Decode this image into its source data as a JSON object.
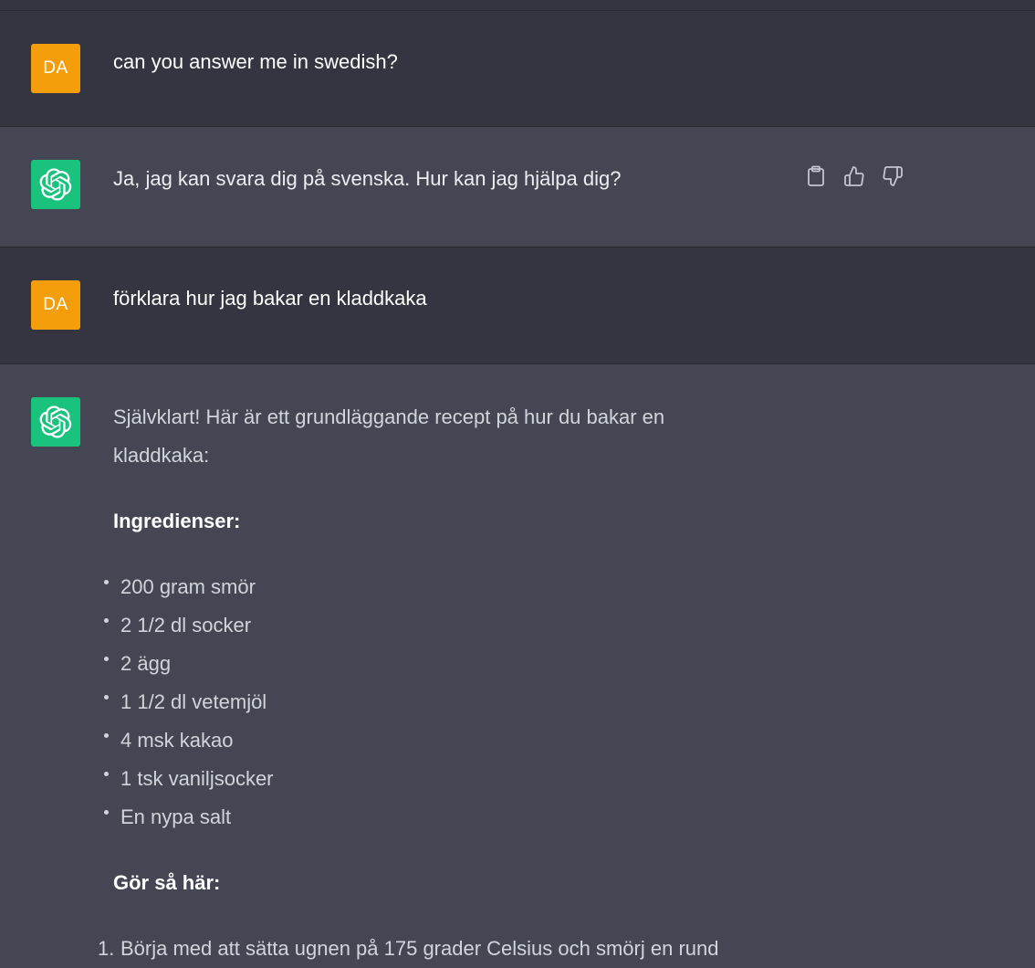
{
  "conversation": {
    "msg1": {
      "avatar": "DA",
      "text": "can you answer me in swedish?"
    },
    "msg2": {
      "text": "Ja, jag kan svara dig på svenska. Hur kan jag hjälpa dig?",
      "actions": [
        "clipboard-icon",
        "thumbs-up-icon",
        "thumbs-down-icon"
      ]
    },
    "msg3": {
      "avatar": "DA",
      "text": "förklara hur jag bakar en kladdkaka"
    },
    "msg4": {
      "intro_line1": "Självklart! Här är ett grundläggande recept på hur du bakar en",
      "intro_line2": "kladdkaka:",
      "ingredients_heading": "Ingredienser:",
      "ingredients": [
        "200 gram smör",
        "2 1/2 dl socker",
        "2 ägg",
        "1 1/2 dl vetemjöl",
        "4 msk kakao",
        "1 tsk vaniljsocker",
        "En nypa salt"
      ],
      "steps_heading": "Gör så här:",
      "steps": [
        {
          "num": "1.",
          "text": "Börja med att sätta ugnen på 175 grader Celsius och smörj en rund"
        }
      ]
    }
  },
  "colors": {
    "user_bg": "#343541",
    "assistant_bg": "#444654",
    "user_avatar": "#f59e0b",
    "bot_avatar": "#19c37d"
  }
}
